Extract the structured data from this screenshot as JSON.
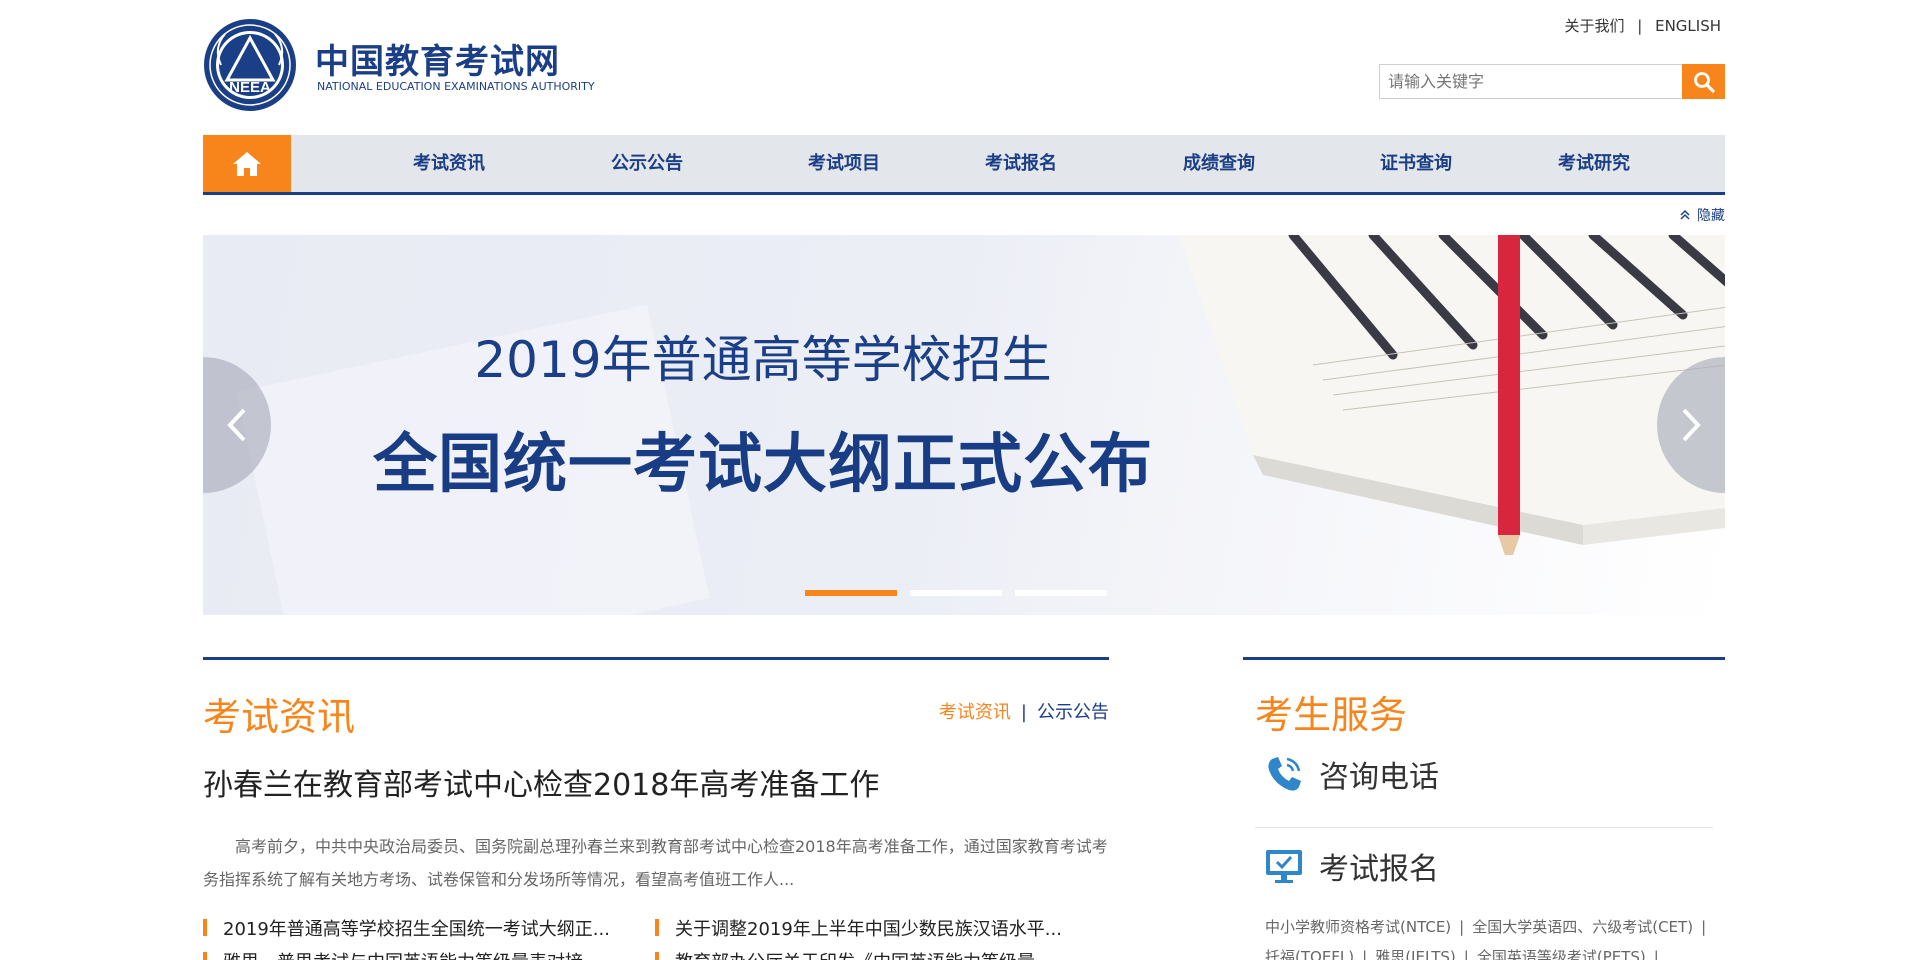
{
  "header": {
    "logo_title": "中国教育考试网",
    "logo_subtitle": "NATIONAL EDUCATION EXAMINATIONS AUTHORITY",
    "logo_badge_text": "NEEA",
    "about_link": "关于我们",
    "top_sep": "|",
    "english_link": "ENGLISH",
    "search_placeholder": "请输入关键字"
  },
  "nav": {
    "items": [
      "考试资讯",
      "公示公告",
      "考试项目",
      "考试报名",
      "成绩查询",
      "证书查询",
      "考试研究"
    ]
  },
  "hide_label": "隐藏",
  "banner": {
    "line1": "2019年普通高等学校招生",
    "line2": "全国统一考试大纲正式公布",
    "slide_count": 3,
    "active_slide": 1
  },
  "news": {
    "title": "考试资讯",
    "tab_active": "考试资讯",
    "tab_sep": "|",
    "tab_other": "公示公告",
    "headline": "孙春兰在教育部考试中心检查2018年高考准备工作",
    "summary": "高考前夕，中共中央政治局委员、国务院副总理孙春兰来到教育部考试中心检查2018年高考准备工作，通过国家教育考试考务指挥系统了解有关地方考场、试卷保管和分发场所等情况，看望高考值班工作人...",
    "items": [
      "2019年普通高等学校招生全国统一考试大纲正...",
      "关于调整2019年上半年中国少数民族汉语水平...",
      "雅思、普思考试与中国英语能力等级量表对接...",
      "教育部办公厅关于印发《中国英语能力等级量..."
    ]
  },
  "services": {
    "title": "考生服务",
    "hotline_label": "咨询电话",
    "register_label": "考试报名",
    "exam_links": [
      "中小学教师资格考试(NTCE)",
      "全国大学英语四、六级考试(CET)",
      "托福(TOEFL)",
      "雅思(IELTS)",
      "全国英语等级考试(PETS)"
    ],
    "link_sep": "|"
  },
  "colors": {
    "brand_blue": "#1b3f86",
    "accent_orange": "#f8851b",
    "nav_bg": "#e3e6ea"
  }
}
